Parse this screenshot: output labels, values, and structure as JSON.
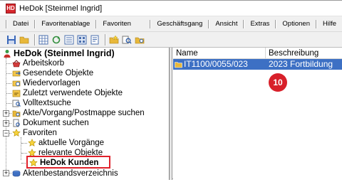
{
  "window": {
    "title": "HeDok [Steinmel Ingrid]",
    "app_icon_text": "HD"
  },
  "menu": [
    "Datei",
    "Favoritenablage",
    "Favoriten bearbeiten",
    "Geschäftsgang",
    "Ansicht",
    "Extras",
    "Optionen",
    "Hilfe"
  ],
  "tree": {
    "root": "HeDok (Steinmel Ingrid)",
    "items": [
      {
        "label": "Arbeitskorb",
        "icon": "basket-icon"
      },
      {
        "label": "Gesendete Objekte",
        "icon": "sent-icon"
      },
      {
        "label": "Wiedervorlagen",
        "icon": "resubmission-icon"
      },
      {
        "label": "Zuletzt verwendete Objekte",
        "icon": "recent-icon"
      },
      {
        "label": "Volltextsuche",
        "icon": "fulltext-search-icon"
      },
      {
        "label": "Akte/Vorgang/Postmappe suchen",
        "icon": "file-search-icon"
      },
      {
        "label": "Dokument suchen",
        "icon": "document-search-icon"
      },
      {
        "label": "Favoriten",
        "icon": "star-icon"
      },
      {
        "label": "aktuelle Vorgänge",
        "icon": "star-icon"
      },
      {
        "label": "relevante Objekte",
        "icon": "star-icon"
      },
      {
        "label": "HeDok Kunden",
        "icon": "star-icon"
      },
      {
        "label": "Aktenbestandsverzeichnis",
        "icon": "archive-icon"
      }
    ]
  },
  "list": {
    "columns": [
      "Name",
      "Beschreibung"
    ],
    "rows": [
      {
        "name": "IT1100/0055/023",
        "description": "2023 Fortbildung"
      }
    ]
  },
  "annotation": {
    "badge": "10"
  },
  "colors": {
    "selection": "#3d70c4",
    "highlight": "#e0212b",
    "badge": "#d8202a"
  }
}
